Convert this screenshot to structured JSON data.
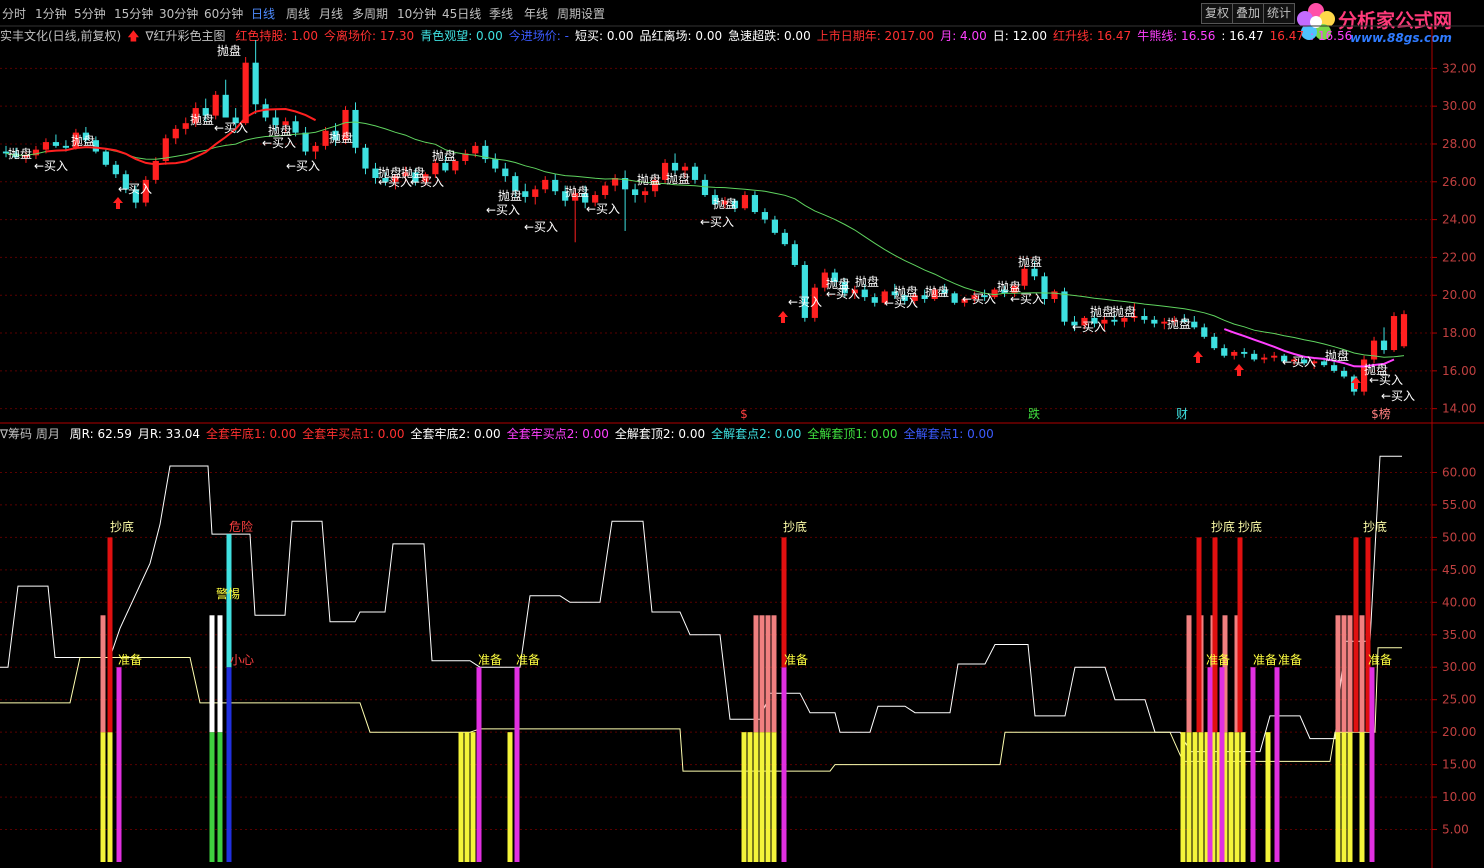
{
  "toolbar": {
    "periods": [
      "分时",
      "1分钟",
      "5分钟",
      "15分钟",
      "30分钟",
      "60分钟",
      "日线",
      "周线",
      "月线",
      "多周期",
      "10分钟",
      "45日线",
      "季线",
      "年线",
      "周期设置"
    ],
    "active_period": "日线",
    "buttons": [
      "复权",
      "叠加",
      "统计"
    ]
  },
  "logo": {
    "title": "分析家公式网",
    "url": "www.88gs.com"
  },
  "main_info": {
    "stock": "实丰文化(日线,前复权)",
    "indicator": "∇红升彩色主图",
    "items": [
      {
        "text": "红色持股: 1.00",
        "color": "#ff3030"
      },
      {
        "text": "今离场价: 17.30",
        "color": "#ff3030"
      },
      {
        "text": "青色观望: 0.00",
        "color": "#3ee0e0"
      },
      {
        "text": "今进场价: -",
        "color": "#3c5bff"
      },
      {
        "text": "短买: 0.00",
        "color": "#ffffff"
      },
      {
        "text": "品红离场: 0.00",
        "color": "#ffffff"
      },
      {
        "text": "急速超跌: 0.00",
        "color": "#ffffff"
      },
      {
        "text": "上市日期年: 2017.00",
        "color": "#ff3030"
      },
      {
        "text": "月: 4.00",
        "color": "#ff40ff"
      },
      {
        "text": "日: 12.00",
        "color": "#ffffff"
      },
      {
        "text": "红升线: 16.47",
        "color": "#ff3030"
      },
      {
        "text": "牛熊线: 16.56",
        "color": "#ff40ff"
      },
      {
        "text": ": 16.47",
        "color": "#ffffff"
      },
      {
        "text": "16.47",
        "color": "#ff3030"
      },
      {
        "text": ": 16.56",
        "color": "#ff40ff"
      }
    ]
  },
  "sub_info": {
    "indicator": "∇筹码 周月",
    "items": [
      {
        "text": "周R: 62.59",
        "color": "#ffffff"
      },
      {
        "text": "月R: 33.04",
        "color": "#ffffff"
      },
      {
        "text": "全套牢底1: 0.00",
        "color": "#ff3030"
      },
      {
        "text": "全套牢买点1: 0.00",
        "color": "#ff3030"
      },
      {
        "text": "全套牢底2: 0.00",
        "color": "#ffffff"
      },
      {
        "text": "全套牢买点2: 0.00",
        "color": "#ff40ff"
      },
      {
        "text": "全解套顶2: 0.00",
        "color": "#ffffff"
      },
      {
        "text": "全解套点2: 0.00",
        "color": "#3ee0e0"
      },
      {
        "text": "全解套顶1: 0.00",
        "color": "#3fdf3f"
      },
      {
        "text": "全解套点1: 0.00",
        "color": "#3c5bff"
      }
    ]
  },
  "colors": {
    "up": "#ff2020",
    "down": "#3ee0e0",
    "grid": "#5a0000",
    "axis": "#b00000",
    "ma_green": "#5fd35f",
    "ma_red": "#ff2020",
    "ma_magenta": "#ff40ff"
  },
  "chart_data": [
    {
      "type": "candlestick",
      "title": "实丰文化(日线,前复权)",
      "ylim": [
        13.4,
        33.5
      ],
      "yticks": [
        14.0,
        16.0,
        18.0,
        20.0,
        22.0,
        24.0,
        26.0,
        28.0,
        30.0,
        32.0
      ],
      "candles": [
        [
          27.6,
          27.9,
          27.3,
          27.5
        ],
        [
          27.5,
          27.8,
          27.2,
          27.3
        ],
        [
          27.3,
          27.6,
          27.0,
          27.4
        ],
        [
          27.4,
          27.9,
          27.2,
          27.7
        ],
        [
          27.7,
          28.3,
          27.5,
          28.1
        ],
        [
          28.1,
          28.5,
          27.8,
          27.9
        ],
        [
          27.9,
          28.2,
          27.6,
          27.8
        ],
        [
          27.8,
          28.8,
          27.7,
          28.6
        ],
        [
          28.6,
          28.9,
          28.0,
          28.2
        ],
        [
          28.2,
          28.4,
          27.5,
          27.6
        ],
        [
          27.6,
          27.7,
          26.8,
          26.9
        ],
        [
          26.9,
          27.1,
          26.2,
          26.4
        ],
        [
          26.4,
          26.6,
          25.4,
          25.6
        ],
        [
          25.6,
          25.8,
          24.6,
          24.9
        ],
        [
          24.9,
          26.3,
          24.7,
          26.1
        ],
        [
          26.1,
          27.3,
          25.9,
          27.1
        ],
        [
          27.1,
          28.5,
          26.9,
          28.3
        ],
        [
          28.3,
          29.0,
          28.0,
          28.8
        ],
        [
          28.8,
          29.4,
          28.5,
          29.1
        ],
        [
          29.1,
          30.2,
          28.9,
          29.9
        ],
        [
          29.9,
          30.4,
          29.2,
          29.5
        ],
        [
          29.5,
          30.8,
          29.3,
          30.6
        ],
        [
          30.6,
          31.4,
          29.8,
          29.4
        ],
        [
          29.4,
          29.9,
          28.6,
          29.1
        ],
        [
          29.1,
          32.6,
          29.0,
          32.3
        ],
        [
          32.3,
          33.5,
          29.6,
          30.1
        ],
        [
          30.1,
          30.4,
          29.2,
          29.4
        ],
        [
          29.4,
          29.8,
          28.7,
          29.0
        ],
        [
          29.0,
          29.4,
          28.6,
          29.2
        ],
        [
          29.2,
          29.5,
          28.4,
          28.6
        ],
        [
          28.6,
          28.9,
          27.4,
          27.6
        ],
        [
          27.6,
          28.1,
          27.2,
          27.9
        ],
        [
          27.9,
          28.9,
          27.7,
          28.7
        ],
        [
          28.7,
          29.1,
          27.9,
          28.2
        ],
        [
          28.2,
          30.0,
          28.0,
          29.8
        ],
        [
          29.8,
          30.2,
          27.5,
          27.8
        ],
        [
          27.8,
          28.0,
          26.4,
          26.7
        ],
        [
          26.7,
          27.0,
          25.9,
          26.2
        ],
        [
          26.2,
          26.5,
          25.8,
          26.0
        ],
        [
          26.0,
          26.4,
          25.6,
          26.3
        ],
        [
          26.3,
          26.8,
          26.0,
          26.5
        ],
        [
          26.5,
          26.7,
          25.8,
          26.0
        ],
        [
          26.0,
          26.5,
          25.8,
          26.4
        ],
        [
          26.4,
          27.2,
          26.2,
          27.0
        ],
        [
          27.0,
          27.4,
          26.5,
          26.6
        ],
        [
          26.6,
          27.2,
          26.4,
          27.1
        ],
        [
          27.1,
          27.7,
          26.9,
          27.5
        ],
        [
          27.5,
          28.1,
          27.3,
          27.9
        ],
        [
          27.9,
          28.2,
          27.0,
          27.2
        ],
        [
          27.2,
          27.5,
          26.5,
          26.7
        ],
        [
          26.7,
          27.0,
          26.0,
          26.3
        ],
        [
          26.3,
          26.5,
          25.2,
          25.5
        ],
        [
          25.5,
          25.9,
          24.9,
          25.2
        ],
        [
          25.2,
          25.8,
          24.8,
          25.6
        ],
        [
          25.6,
          26.3,
          25.4,
          26.1
        ],
        [
          26.1,
          26.4,
          25.3,
          25.5
        ],
        [
          25.5,
          25.8,
          24.7,
          25.0
        ],
        [
          25.0,
          25.6,
          22.8,
          25.4
        ],
        [
          25.4,
          25.8,
          24.6,
          24.9
        ],
        [
          24.9,
          25.5,
          24.7,
          25.3
        ],
        [
          25.3,
          26.0,
          25.1,
          25.8
        ],
        [
          25.8,
          26.4,
          25.5,
          26.2
        ],
        [
          26.2,
          26.6,
          23.4,
          25.6
        ],
        [
          25.6,
          25.9,
          24.9,
          25.3
        ],
        [
          25.3,
          25.7,
          24.9,
          25.5
        ],
        [
          25.5,
          26.3,
          25.2,
          26.1
        ],
        [
          26.1,
          27.2,
          25.9,
          27.0
        ],
        [
          27.0,
          27.5,
          26.4,
          26.6
        ],
        [
          26.6,
          27.0,
          26.2,
          26.8
        ],
        [
          26.8,
          27.0,
          25.9,
          26.1
        ],
        [
          26.1,
          26.4,
          25.2,
          25.3
        ],
        [
          25.3,
          25.6,
          24.6,
          24.8
        ],
        [
          24.8,
          25.2,
          24.6,
          25.0
        ],
        [
          25.0,
          25.1,
          24.4,
          24.6
        ],
        [
          24.6,
          25.5,
          24.5,
          25.3
        ],
        [
          25.3,
          25.5,
          24.3,
          24.4
        ],
        [
          24.4,
          24.6,
          23.8,
          24.0
        ],
        [
          24.0,
          24.2,
          23.2,
          23.3
        ],
        [
          23.3,
          23.5,
          22.6,
          22.7
        ],
        [
          22.7,
          22.9,
          21.5,
          21.6
        ],
        [
          21.6,
          21.8,
          18.6,
          18.8
        ],
        [
          18.8,
          20.6,
          18.6,
          20.4
        ],
        [
          20.4,
          21.4,
          20.2,
          21.2
        ],
        [
          21.2,
          21.4,
          20.5,
          20.7
        ],
        [
          20.7,
          20.9,
          19.9,
          20.1
        ],
        [
          20.1,
          20.5,
          19.8,
          20.3
        ],
        [
          20.3,
          20.6,
          19.7,
          19.9
        ],
        [
          19.9,
          20.1,
          19.4,
          19.6
        ],
        [
          19.6,
          20.3,
          19.5,
          20.2
        ],
        [
          20.2,
          20.6,
          19.8,
          20.0
        ],
        [
          20.0,
          20.2,
          19.5,
          19.7
        ],
        [
          19.7,
          20.1,
          19.5,
          20.0
        ],
        [
          20.0,
          20.3,
          19.6,
          19.8
        ],
        [
          19.8,
          20.4,
          19.7,
          20.3
        ],
        [
          20.3,
          20.6,
          19.9,
          20.1
        ],
        [
          20.1,
          20.2,
          19.5,
          19.6
        ],
        [
          19.6,
          19.9,
          19.4,
          19.8
        ],
        [
          19.8,
          20.2,
          19.6,
          20.0
        ],
        [
          20.0,
          20.3,
          19.7,
          19.9
        ],
        [
          19.9,
          20.4,
          19.8,
          20.3
        ],
        [
          20.3,
          20.5,
          19.9,
          20.1
        ],
        [
          20.1,
          20.6,
          19.9,
          20.5
        ],
        [
          20.5,
          21.6,
          20.3,
          21.4
        ],
        [
          21.4,
          21.8,
          20.8,
          21.0
        ],
        [
          21.0,
          21.2,
          19.5,
          19.8
        ],
        [
          19.8,
          20.3,
          19.6,
          20.2
        ],
        [
          20.2,
          20.4,
          18.4,
          18.6
        ],
        [
          18.6,
          18.9,
          18.1,
          18.4
        ],
        [
          18.4,
          18.9,
          18.2,
          18.8
        ],
        [
          18.8,
          19.1,
          18.3,
          18.5
        ],
        [
          18.5,
          18.9,
          18.1,
          18.7
        ],
        [
          18.7,
          19.0,
          18.4,
          18.6
        ],
        [
          18.6,
          18.9,
          18.3,
          18.8
        ],
        [
          18.8,
          19.6,
          18.6,
          18.9
        ],
        [
          18.9,
          19.3,
          18.5,
          18.7
        ],
        [
          18.7,
          18.9,
          18.3,
          18.5
        ],
        [
          18.5,
          18.8,
          18.2,
          18.6
        ],
        [
          18.6,
          18.9,
          18.4,
          18.7
        ],
        [
          18.7,
          19.0,
          18.5,
          18.6
        ],
        [
          18.6,
          18.9,
          18.2,
          18.3
        ],
        [
          18.3,
          18.5,
          17.7,
          17.8
        ],
        [
          17.8,
          18.0,
          17.1,
          17.2
        ],
        [
          17.2,
          17.4,
          16.7,
          16.8
        ],
        [
          16.8,
          17.1,
          16.6,
          17.0
        ],
        [
          17.0,
          17.2,
          16.7,
          16.9
        ],
        [
          16.9,
          17.1,
          16.5,
          16.6
        ],
        [
          16.6,
          16.9,
          16.4,
          16.7
        ],
        [
          16.7,
          17.0,
          16.5,
          16.8
        ],
        [
          16.8,
          16.9,
          16.4,
          16.5
        ],
        [
          16.5,
          16.7,
          16.3,
          16.6
        ],
        [
          16.6,
          16.8,
          16.3,
          16.4
        ],
        [
          16.4,
          16.6,
          16.1,
          16.5
        ],
        [
          16.5,
          16.7,
          16.2,
          16.3
        ],
        [
          16.3,
          16.5,
          15.9,
          16.0
        ],
        [
          16.0,
          16.2,
          15.6,
          15.7
        ],
        [
          15.7,
          15.8,
          14.7,
          14.9
        ],
        [
          14.9,
          16.8,
          14.7,
          16.6
        ],
        [
          16.6,
          17.8,
          16.4,
          17.6
        ],
        [
          17.6,
          18.3,
          16.9,
          17.1
        ],
        [
          17.1,
          19.1,
          17.0,
          18.9
        ],
        [
          17.3,
          19.2,
          17.2,
          19.0
        ]
      ]
    },
    {
      "type": "bar+line",
      "title": "∇筹码 周月",
      "ylim": [
        0,
        65
      ],
      "yticks": [
        5.0,
        10.0,
        15.0,
        20.0,
        25.0,
        30.0,
        35.0,
        40.0,
        45.0,
        50.0,
        55.0,
        60.0
      ]
    }
  ],
  "main_labels": {
    "sell": "抛盘",
    "buy": "←买入",
    "markers": [
      "$",
      "跌",
      "财",
      "$榜"
    ]
  },
  "sub_labels": {
    "bottom": "抄底",
    "ready": "准备",
    "danger": "危险",
    "alert": "警惕",
    "careful": "小心"
  }
}
